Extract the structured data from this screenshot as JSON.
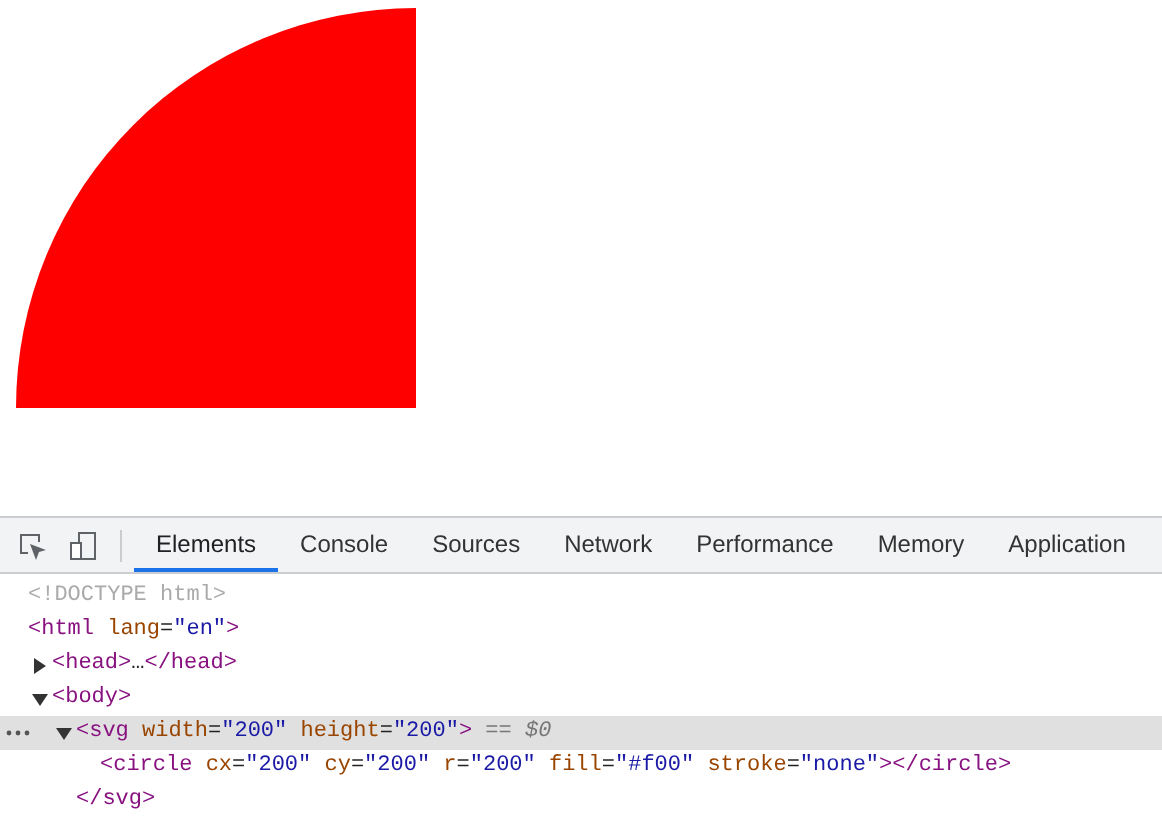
{
  "devtools": {
    "tabs": [
      {
        "label": "Elements",
        "selected": true
      },
      {
        "label": "Console",
        "selected": false
      },
      {
        "label": "Sources",
        "selected": false
      },
      {
        "label": "Network",
        "selected": false
      },
      {
        "label": "Performance",
        "selected": false
      },
      {
        "label": "Memory",
        "selected": false
      },
      {
        "label": "Application",
        "selected": false
      }
    ],
    "dom": [
      {
        "tokens": [
          {
            "kind": "comment",
            "text": "<!DOCTYPE html>"
          }
        ],
        "selected": false
      },
      {
        "tokens": [
          {
            "kind": "tag",
            "text": "<html"
          },
          {
            "kind": "attr",
            "text": "lang"
          },
          {
            "kind": "punct",
            "text": "="
          },
          {
            "kind": "value",
            "text": "\"en\""
          },
          {
            "kind": "tag",
            "text": ">"
          }
        ],
        "selected": false,
        "children": [
          {
            "tokens": [
              {
                "kind": "tag",
                "text": "<head>"
              },
              {
                "kind": "punct",
                "text": "…"
              },
              {
                "kind": "tag",
                "text": "</head>"
              }
            ],
            "expanded": false,
            "selected": false
          },
          {
            "tokens": [
              {
                "kind": "tag",
                "text": "<body>"
              }
            ],
            "expanded": true,
            "selected": false,
            "children": [
              {
                "tokens": [
                  {
                    "kind": "tag",
                    "text": "<svg"
                  },
                  {
                    "kind": "attr",
                    "text": "width"
                  },
                  {
                    "kind": "punct",
                    "text": "="
                  },
                  {
                    "kind": "value",
                    "text": "\"200\""
                  },
                  {
                    "kind": "attr",
                    "text": "height"
                  },
                  {
                    "kind": "punct",
                    "text": "="
                  },
                  {
                    "kind": "value",
                    "text": "\"200\""
                  },
                  {
                    "kind": "tag",
                    "text": ">"
                  },
                  {
                    "kind": "hint",
                    "text": "== $0"
                  }
                ],
                "expanded": true,
                "selected": true,
                "children": [
                  {
                    "tokens": [
                      {
                        "kind": "tag",
                        "text": "<circle"
                      },
                      {
                        "kind": "attr",
                        "text": "cx"
                      },
                      {
                        "kind": "punct",
                        "text": "="
                      },
                      {
                        "kind": "value",
                        "text": "\"200\""
                      },
                      {
                        "kind": "attr",
                        "text": "cy"
                      },
                      {
                        "kind": "punct",
                        "text": "="
                      },
                      {
                        "kind": "value",
                        "text": "\"200\""
                      },
                      {
                        "kind": "attr",
                        "text": "r"
                      },
                      {
                        "kind": "punct",
                        "text": "="
                      },
                      {
                        "kind": "value",
                        "text": "\"200\""
                      },
                      {
                        "kind": "attr",
                        "text": "fill"
                      },
                      {
                        "kind": "punct",
                        "text": "="
                      },
                      {
                        "kind": "value",
                        "text": "\"#f00\""
                      },
                      {
                        "kind": "attr",
                        "text": "stroke"
                      },
                      {
                        "kind": "punct",
                        "text": "="
                      },
                      {
                        "kind": "value",
                        "text": "\"none\""
                      },
                      {
                        "kind": "tag",
                        "text": "></circle>"
                      }
                    ],
                    "selected": false
                  }
                ],
                "closing": [
                  {
                    "kind": "tag",
                    "text": "</svg>"
                  }
                ]
              }
            ]
          }
        ]
      }
    ]
  }
}
